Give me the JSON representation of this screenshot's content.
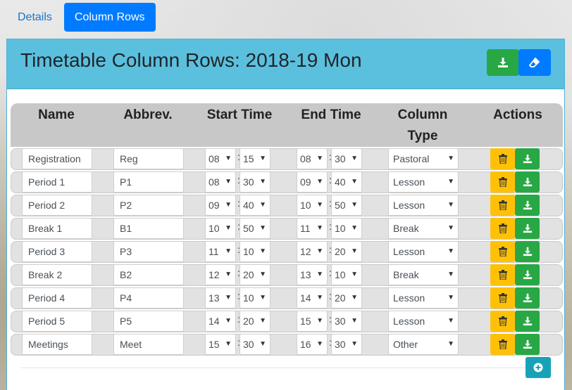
{
  "tabs": [
    {
      "label": "Details"
    },
    {
      "label": "Column Rows"
    }
  ],
  "panel": {
    "title": "Timetable Column Rows: 2018-19 Mon"
  },
  "table": {
    "headers": {
      "name": "Name",
      "abbrev": "Abbrev.",
      "start": "Start Time",
      "end": "End Time",
      "type_line1": "Column",
      "type_line2": "Type",
      "actions": "Actions"
    },
    "rows": [
      {
        "name": "Registration",
        "abbrev": "Reg",
        "sh": "08",
        "sm": "15",
        "eh": "08",
        "em": "30",
        "type": "Pastoral"
      },
      {
        "name": "Period 1",
        "abbrev": "P1",
        "sh": "08",
        "sm": "30",
        "eh": "09",
        "em": "40",
        "type": "Lesson"
      },
      {
        "name": "Period 2",
        "abbrev": "P2",
        "sh": "09",
        "sm": "40",
        "eh": "10",
        "em": "50",
        "type": "Lesson"
      },
      {
        "name": "Break 1",
        "abbrev": "B1",
        "sh": "10",
        "sm": "50",
        "eh": "11",
        "em": "10",
        "type": "Break"
      },
      {
        "name": "Period 3",
        "abbrev": "P3",
        "sh": "11",
        "sm": "10",
        "eh": "12",
        "em": "20",
        "type": "Lesson"
      },
      {
        "name": "Break 2",
        "abbrev": "B2",
        "sh": "12",
        "sm": "20",
        "eh": "13",
        "em": "10",
        "type": "Break"
      },
      {
        "name": "Period 4",
        "abbrev": "P4",
        "sh": "13",
        "sm": "10",
        "eh": "14",
        "em": "20",
        "type": "Lesson"
      },
      {
        "name": "Period 5",
        "abbrev": "P5",
        "sh": "14",
        "sm": "20",
        "eh": "15",
        "em": "30",
        "type": "Lesson"
      },
      {
        "name": "Meetings",
        "abbrev": "Meet",
        "sh": "15",
        "sm": "30",
        "eh": "16",
        "em": "30",
        "type": "Other"
      }
    ],
    "time_separator": ":",
    "caret": "▼"
  },
  "icons": {
    "header_green": "download-icon",
    "header_blue": "eraser-icon",
    "row_delete": "trash-icon",
    "row_save": "download-icon",
    "add": "plus-circle-icon"
  },
  "colors": {
    "primary": "#007bff",
    "success": "#28a745",
    "warning": "#ffc107",
    "info": "#5bc0de",
    "add_button": "#17a2b8"
  }
}
